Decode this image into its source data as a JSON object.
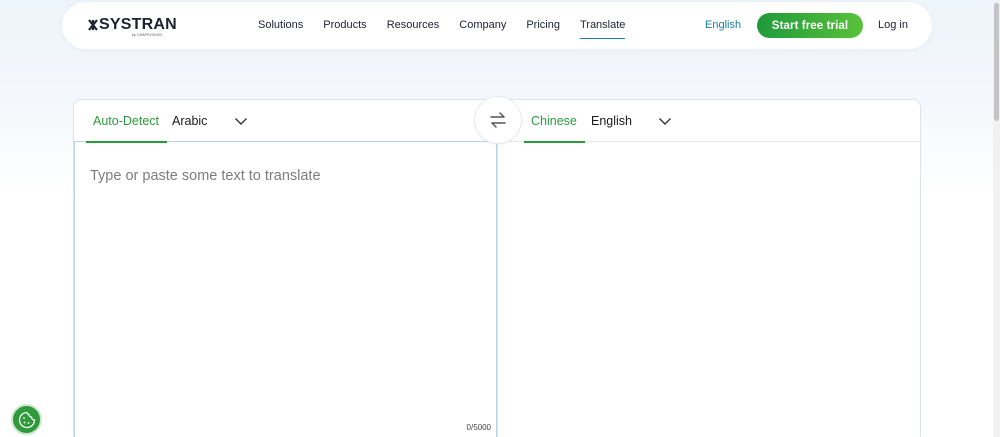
{
  "header": {
    "logo_text": "SYSTRAN",
    "logo_sub": "by CHAPSVISION",
    "nav": [
      "Solutions",
      "Products",
      "Resources",
      "Company",
      "Pricing",
      "Translate"
    ],
    "active_nav": "Translate",
    "language": "English",
    "cta_label": "Start free trial",
    "login_label": "Log in"
  },
  "translator": {
    "source": {
      "auto_detect": "Auto-Detect",
      "language": "Arabic",
      "placeholder": "Type or paste some text to translate",
      "counter": "0/5000"
    },
    "target": {
      "active_language": "Chinese",
      "language": "English"
    }
  },
  "icons": {
    "swap": "swap-arrows-icon",
    "chevron": "chevron-down-icon",
    "cookie": "cookie-icon"
  },
  "colors": {
    "accent_green": "#2c9a3c",
    "accent_blue": "#1a7fa6",
    "cta_gradient_start": "#1f9a3a",
    "cta_gradient_end": "#58c23a"
  }
}
